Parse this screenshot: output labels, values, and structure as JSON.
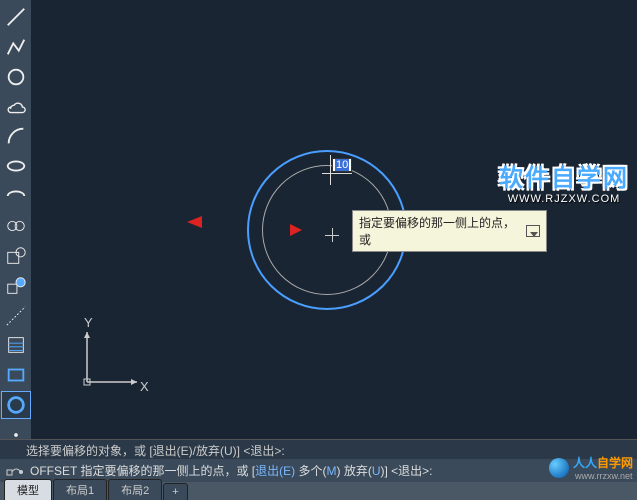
{
  "left_tools": [
    {
      "name": "line-icon"
    },
    {
      "name": "polyline-icon"
    },
    {
      "name": "circle-icon"
    },
    {
      "name": "cloud-icon"
    },
    {
      "name": "arc-icon"
    },
    {
      "name": "ellipse-icon"
    },
    {
      "name": "ellipse-arc-icon"
    },
    {
      "name": "revision-cloud-icon"
    },
    {
      "name": "rect-combo-icon"
    },
    {
      "name": "rect-circle-icon"
    },
    {
      "name": "construction-line-icon"
    },
    {
      "name": "hatch-icon"
    },
    {
      "name": "rectangle-icon"
    },
    {
      "name": "donut-icon"
    },
    {
      "name": "point-icon"
    }
  ],
  "top_tools": [
    {
      "name": "erase-icon"
    },
    {
      "name": "zoom-icon"
    },
    {
      "name": "mirror-icon"
    },
    {
      "name": "offset-icon"
    },
    {
      "name": "array-icon"
    },
    {
      "name": "move-icon"
    },
    {
      "name": "rotate-icon"
    },
    {
      "name": "scale-icon"
    },
    {
      "name": "stretch-icon"
    },
    {
      "name": "trim-icon"
    },
    {
      "name": "extend-icon"
    },
    {
      "name": "break-icon"
    },
    {
      "name": "join-icon"
    }
  ],
  "dim_value": "10",
  "tooltip_text": "指定要偏移的那一侧上的点，或",
  "ucs": {
    "x": "X",
    "y": "Y"
  },
  "watermark": {
    "main": "软件自学网",
    "url": "WWW.RJZXW.COM"
  },
  "cmd_history": "选择要偏移的对象，或 [退出(E)/放弃(U)] <退出>:",
  "cmd_active": {
    "command": "OFFSET",
    "prompt": "指定要偏移的那一侧上的点，或 [",
    "opt1": "退出(E)",
    "sep1": " 多个(",
    "opt2": "M",
    "sep2": ") 放弃(",
    "opt3": "U",
    "sep3": ")] <退出>:"
  },
  "tabs": [
    {
      "label": "模型",
      "active": true
    },
    {
      "label": "布局1",
      "active": false
    },
    {
      "label": "布局2",
      "active": false
    }
  ],
  "tab_plus": "+",
  "bottom_watermark": {
    "t1": "人人",
    "t2": "自学网",
    "url": "www.rrzxw.net"
  }
}
